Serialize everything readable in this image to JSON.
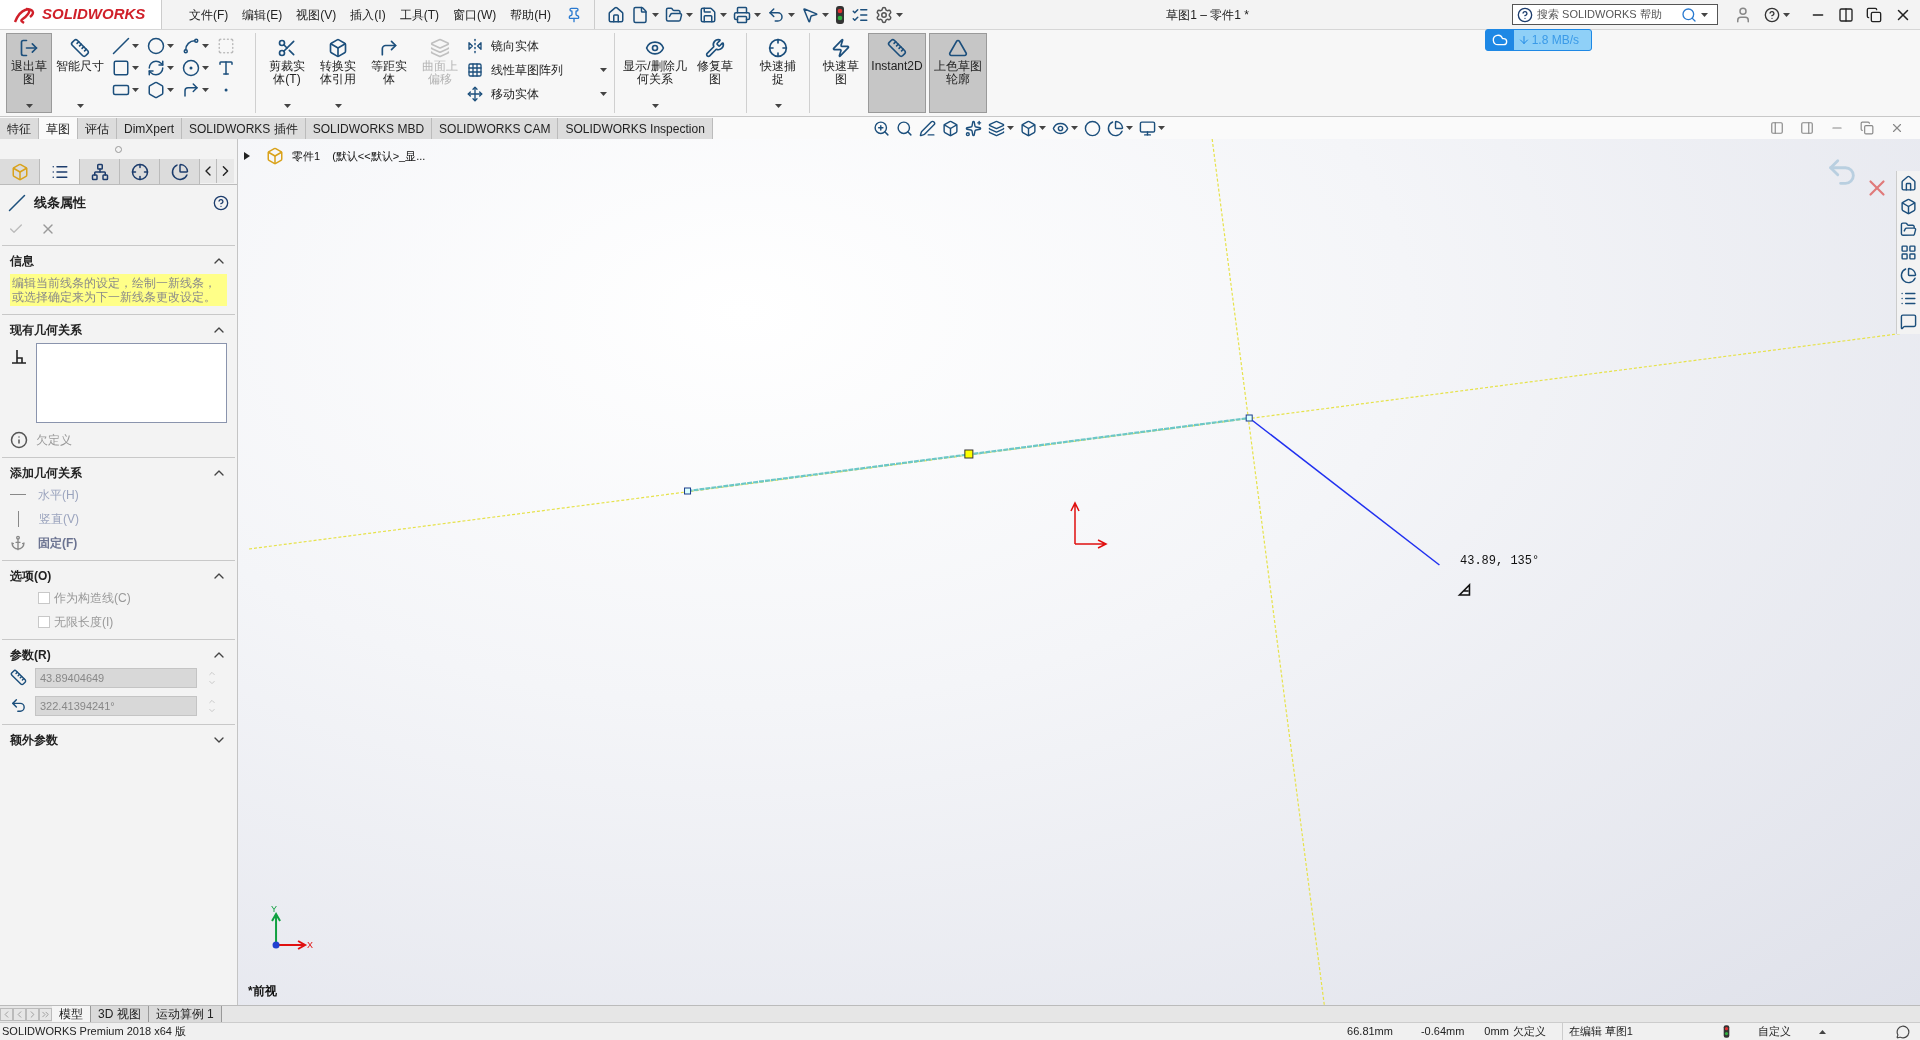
{
  "title_bar": {
    "logo": "SOLIDWORKS",
    "menus": [
      "文件(F)",
      "编辑(E)",
      "视图(V)",
      "插入(I)",
      "工具(T)",
      "窗口(W)",
      "帮助(H)"
    ],
    "document_title": "草图1 – 零件1 *",
    "search": {
      "placeholder": "搜索 SOLIDWORKS 帮助"
    }
  },
  "download_badge": {
    "speed": "1.8 MB/s"
  },
  "ribbon": {
    "buttons_left": [
      {
        "label": "退出草图",
        "selected": true,
        "disabled": false,
        "dropdown": true
      },
      {
        "label": "智能尺寸",
        "selected": false,
        "disabled": false,
        "dropdown": true
      }
    ],
    "buttons_mid": [
      {
        "label": "剪裁实体(T)",
        "selected": false,
        "disabled": false,
        "dropdown": true
      },
      {
        "label": "转换实体引用",
        "selected": false,
        "disabled": false,
        "dropdown": true
      },
      {
        "label": "等距实体",
        "selected": false,
        "disabled": false,
        "dropdown": false
      },
      {
        "label": "曲面上偏移",
        "selected": false,
        "disabled": true,
        "dropdown": false
      }
    ],
    "list": [
      {
        "label": "镜向实体",
        "dropdown": false
      },
      {
        "label": "线性草图阵列",
        "dropdown": true
      },
      {
        "label": "移动实体",
        "dropdown": true
      }
    ],
    "buttons_right": [
      {
        "label": "显示/删除几何关系",
        "selected": false,
        "disabled": false,
        "dropdown": true
      },
      {
        "label": "修复草图",
        "selected": false,
        "disabled": false,
        "dropdown": false
      },
      {
        "label": "快速捕捉",
        "selected": false,
        "disabled": false,
        "dropdown": true
      },
      {
        "label": "快速草图",
        "selected": false,
        "disabled": false,
        "dropdown": false
      },
      {
        "label": "Instant2D",
        "selected": true,
        "disabled": false,
        "dropdown": false
      },
      {
        "label": "上色草图轮廓",
        "selected": true,
        "disabled": false,
        "dropdown": false
      }
    ]
  },
  "command_tabs": [
    {
      "label": "特征",
      "selected": false
    },
    {
      "label": "草图",
      "selected": true
    },
    {
      "label": "评估",
      "selected": false
    },
    {
      "label": "DimXpert",
      "selected": false
    },
    {
      "label": "SOLIDWORKS 插件",
      "selected": false
    },
    {
      "label": "SOLIDWORKS MBD",
      "selected": false
    },
    {
      "label": "SOLIDWORKS CAM",
      "selected": false
    },
    {
      "label": "SOLIDWORKS Inspection",
      "selected": false
    }
  ],
  "feature_tree": {
    "item": "零件1",
    "configuration": "(默认<<默认>_显..."
  },
  "property_manager": {
    "tabs": [
      {
        "selected": false
      },
      {
        "selected": true
      },
      {
        "selected": false
      },
      {
        "selected": false
      },
      {
        "selected": false
      }
    ],
    "title": "线条属性",
    "sections": [
      {
        "kind": "info",
        "title": "信息",
        "expanded": true,
        "message": "编辑当前线条的设定，绘制一新线条，或选择确定来为下一新线条更改设定。"
      },
      {
        "kind": "relations",
        "title": "现有几何关系",
        "expanded": true,
        "status": "欠定义"
      },
      {
        "kind": "add_relations",
        "title": "添加几何关系",
        "expanded": true,
        "items": [
          {
            "label": "水平(H)",
            "disabled": true
          },
          {
            "label": "竖直(V)",
            "disabled": true
          },
          {
            "label": "固定(F)",
            "disabled": false
          }
        ]
      },
      {
        "kind": "options",
        "title": "选项(O)",
        "expanded": true,
        "items": [
          {
            "label": "作为构造线(C)",
            "checked": false
          },
          {
            "label": "无限长度(I)",
            "checked": false
          }
        ]
      },
      {
        "kind": "parameters",
        "title": "参数(R)",
        "expanded": true,
        "fields": [
          {
            "value": "43.89404649"
          },
          {
            "value": "322.41394241°"
          }
        ]
      },
      {
        "kind": "extra",
        "title": "额外参数",
        "expanded": false
      }
    ]
  },
  "graphics": {
    "dimension": "43.89, 135°",
    "view_name": "*前视",
    "axes": [
      "Y",
      "X"
    ]
  },
  "model_tabs": [
    {
      "label": "模型",
      "selected": true
    },
    {
      "label": "3D 视图",
      "selected": false
    },
    {
      "label": "运动算例 1",
      "selected": false
    }
  ],
  "status_bar": {
    "product": "SOLIDWORKS Premium 2018 x64 版",
    "x": "66.81mm",
    "y": "-0.64mm",
    "z": "0mm",
    "sketch_state": "欠定义",
    "editing": "在编辑 草图1",
    "units": "自定义"
  }
}
